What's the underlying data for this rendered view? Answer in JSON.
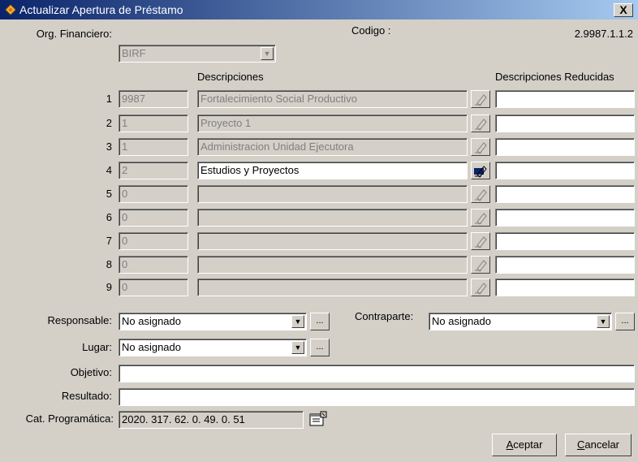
{
  "window": {
    "title": "Actualizar Apertura de Préstamo",
    "close_label": "X"
  },
  "org": {
    "label": "Org. Financiero:",
    "value": "BIRF"
  },
  "codigo": {
    "label": "Codigo :",
    "value": "2.9987.1.1.2"
  },
  "headers": {
    "descripciones": "Descripciones",
    "reducidas": "Descripciones Reducidas"
  },
  "rows": [
    {
      "num": "1",
      "code": "9987",
      "desc": "Fortalecimiento Social Productivo",
      "reduced": ""
    },
    {
      "num": "2",
      "code": "1",
      "desc": "Proyecto 1",
      "reduced": ""
    },
    {
      "num": "3",
      "code": "1",
      "desc": "Administracion Unidad Ejecutora",
      "reduced": ""
    },
    {
      "num": "4",
      "code": "2",
      "desc": "Estudios y Proyectos",
      "reduced": ""
    },
    {
      "num": "5",
      "code": "0",
      "desc": "",
      "reduced": ""
    },
    {
      "num": "6",
      "code": "0",
      "desc": "",
      "reduced": ""
    },
    {
      "num": "7",
      "code": "0",
      "desc": "",
      "reduced": ""
    },
    {
      "num": "8",
      "code": "0",
      "desc": "",
      "reduced": ""
    },
    {
      "num": "9",
      "code": "0",
      "desc": "",
      "reduced": ""
    }
  ],
  "responsable": {
    "label": "Responsable:",
    "value": "No asignado"
  },
  "contraparte": {
    "label": "Contraparte:",
    "value": "No asignado"
  },
  "lugar": {
    "label": "Lugar:",
    "value": "No asignado"
  },
  "objetivo": {
    "label": "Objetivo:",
    "value": ""
  },
  "resultado": {
    "label": "Resultado:",
    "value": ""
  },
  "cat": {
    "label": "Cat. Programática:",
    "value": "2020. 317. 62. 0. 49. 0. 51"
  },
  "ellipsis": "...",
  "buttons": {
    "aceptar": {
      "accel": "A",
      "rest": "ceptar"
    },
    "cancelar": {
      "accel": "C",
      "rest": "ancelar"
    }
  }
}
